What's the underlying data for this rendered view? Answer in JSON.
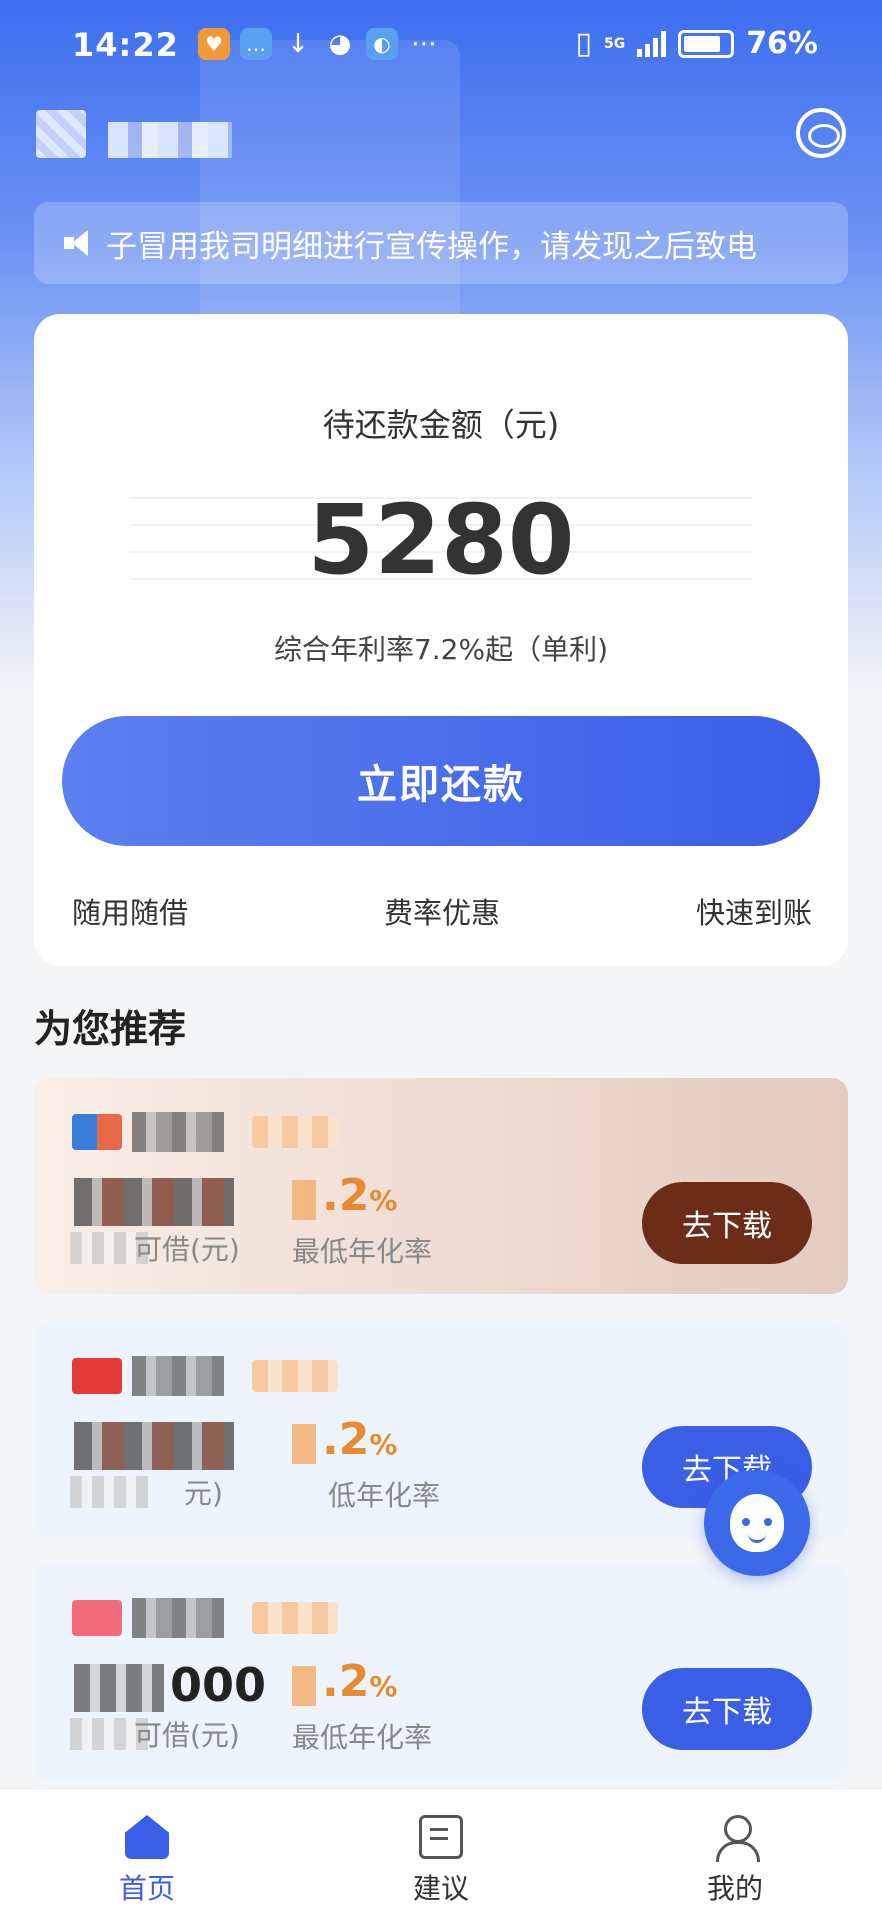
{
  "status_bar": {
    "time": "14:22",
    "network": "5G",
    "battery": "76%"
  },
  "header": {
    "notice": "子冒用我司明细进行宣传操作，请发现之后致电"
  },
  "repay_card": {
    "amount_label": "待还款金额（元)",
    "amount": "5280",
    "rate_text": "综合年利率7.2%起（单利)",
    "button_label": "立即还款",
    "features": [
      "随用随借",
      "费率优惠",
      "快速到账"
    ]
  },
  "recommend": {
    "title": "为您推荐",
    "items": [
      {
        "amount_tail": "",
        "limit_label": "可借(元)",
        "rate": ".2",
        "rate_unit": "%",
        "rate_label": "最低年化率",
        "button": "去下载"
      },
      {
        "amount_tail": "",
        "limit_label": "元)",
        "rate": ".2",
        "rate_unit": "%",
        "rate_label": "低年化率",
        "button": "去下载"
      },
      {
        "amount_tail": "000",
        "limit_label": "可借(元)",
        "rate": ".2",
        "rate_unit": "%",
        "rate_label": "最低年化率",
        "button": "去下载"
      }
    ]
  },
  "tabs": [
    {
      "label": "首页",
      "icon": "home-icon",
      "active": true
    },
    {
      "label": "建议",
      "icon": "feedback-icon",
      "active": false
    },
    {
      "label": "我的",
      "icon": "user-icon",
      "active": false
    }
  ],
  "colors": {
    "primary": "#3a5ee6",
    "rate": "#e88a2e",
    "card1_button": "#6b2c18"
  }
}
